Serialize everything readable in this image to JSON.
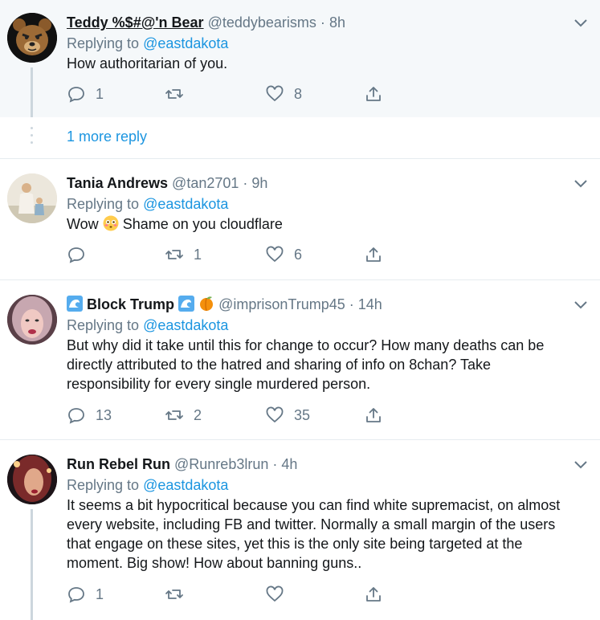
{
  "tweets": [
    {
      "name": "Teddy %$#@'n Bear",
      "handle": "@teddybearisms",
      "dot": "·",
      "time": "8h",
      "replying_label": "Replying to",
      "replying_to": "@eastdakota",
      "text": "How authoritarian of you.",
      "reply_count": "1",
      "retweet_count": "",
      "like_count": "8"
    },
    {
      "name": "Tania Andrews",
      "handle": "@tan2701",
      "dot": "·",
      "time": "9h",
      "replying_label": "Replying to",
      "replying_to": "@eastdakota",
      "text_before": "Wow",
      "text_after": "Shame on you cloudflare",
      "reply_count": "",
      "retweet_count": "1",
      "like_count": "6"
    },
    {
      "name": "Block Trump",
      "handle": "@imprisonTrump45",
      "dot": "·",
      "time": "14h",
      "replying_label": "Replying to",
      "replying_to": "@eastdakota",
      "text": "But why did it take until this for change to occur? How many deaths can be directly attributed to the hatred and sharing of info on 8chan? Take responsibility for every single murdered person.",
      "reply_count": "13",
      "retweet_count": "2",
      "like_count": "35"
    },
    {
      "name": "Run Rebel Run",
      "handle": "@Runreb3lrun",
      "dot": "·",
      "time": "4h",
      "replying_label": "Replying to",
      "replying_to": "@eastdakota",
      "text": "It seems a bit hypocritical because you can find white supremacist, on almost every website, including FB and twitter. Normally a small margin of the users that engage on these sites, yet this is the only site being targeted at the moment. Big show! How about banning guns..",
      "reply_count": "1",
      "retweet_count": "",
      "like_count": ""
    }
  ],
  "more_replies": "1 more reply",
  "icons": {
    "reply": "reply-icon",
    "retweet": "retweet-icon",
    "like": "heart-icon",
    "share": "share-icon",
    "menu": "chevron-down-icon"
  },
  "colors": {
    "link": "#1b95e0",
    "muted": "#657786",
    "highlight_bg": "#f5f8fa",
    "divider": "#e6ecf0"
  }
}
